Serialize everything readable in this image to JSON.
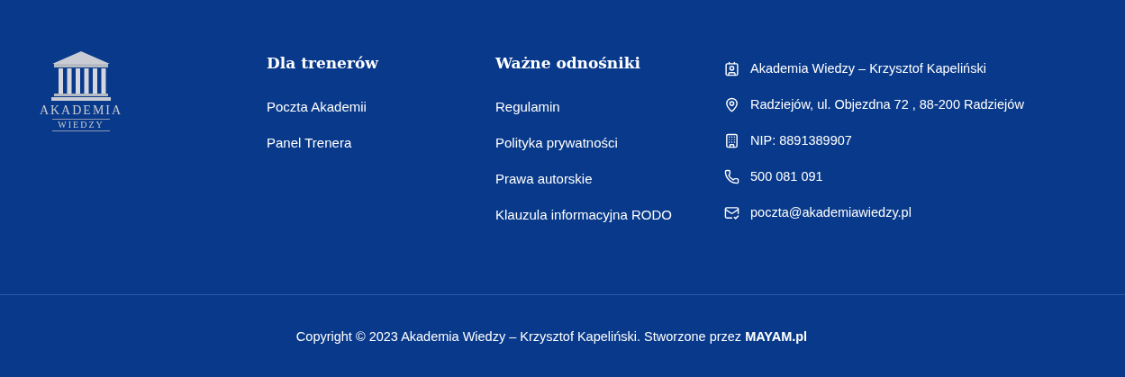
{
  "logo": {
    "line_1": "AKADEMIA",
    "line_2": "WIEDZY"
  },
  "columns": [
    {
      "title": "Dla trenerów",
      "links": [
        "Poczta Akademii",
        "Panel Trenera"
      ]
    },
    {
      "title": "Ważne odnośniki",
      "links": [
        "Regulamin",
        "Polityka prywatności",
        "Prawa autorskie",
        "Klauzula informacyjna RODO"
      ]
    }
  ],
  "contact": [
    {
      "kind": "contact",
      "text": "Akademia Wiedzy – Krzysztof Kapeliński"
    },
    {
      "kind": "location",
      "text": "Radziejów, ul. Objezdna 72 , 88-200 Radziejów"
    },
    {
      "kind": "building",
      "text": "NIP: 8891389907"
    },
    {
      "kind": "phone",
      "text": "500 081 091"
    },
    {
      "kind": "mail",
      "text": "poczta@akademiawiedzy.pl"
    }
  ],
  "copyright": "Copyright © 2023 Akademia Wiedzy – Krzysztof Kapeliński. Stworzone przez **MAYAM.pl**"
}
